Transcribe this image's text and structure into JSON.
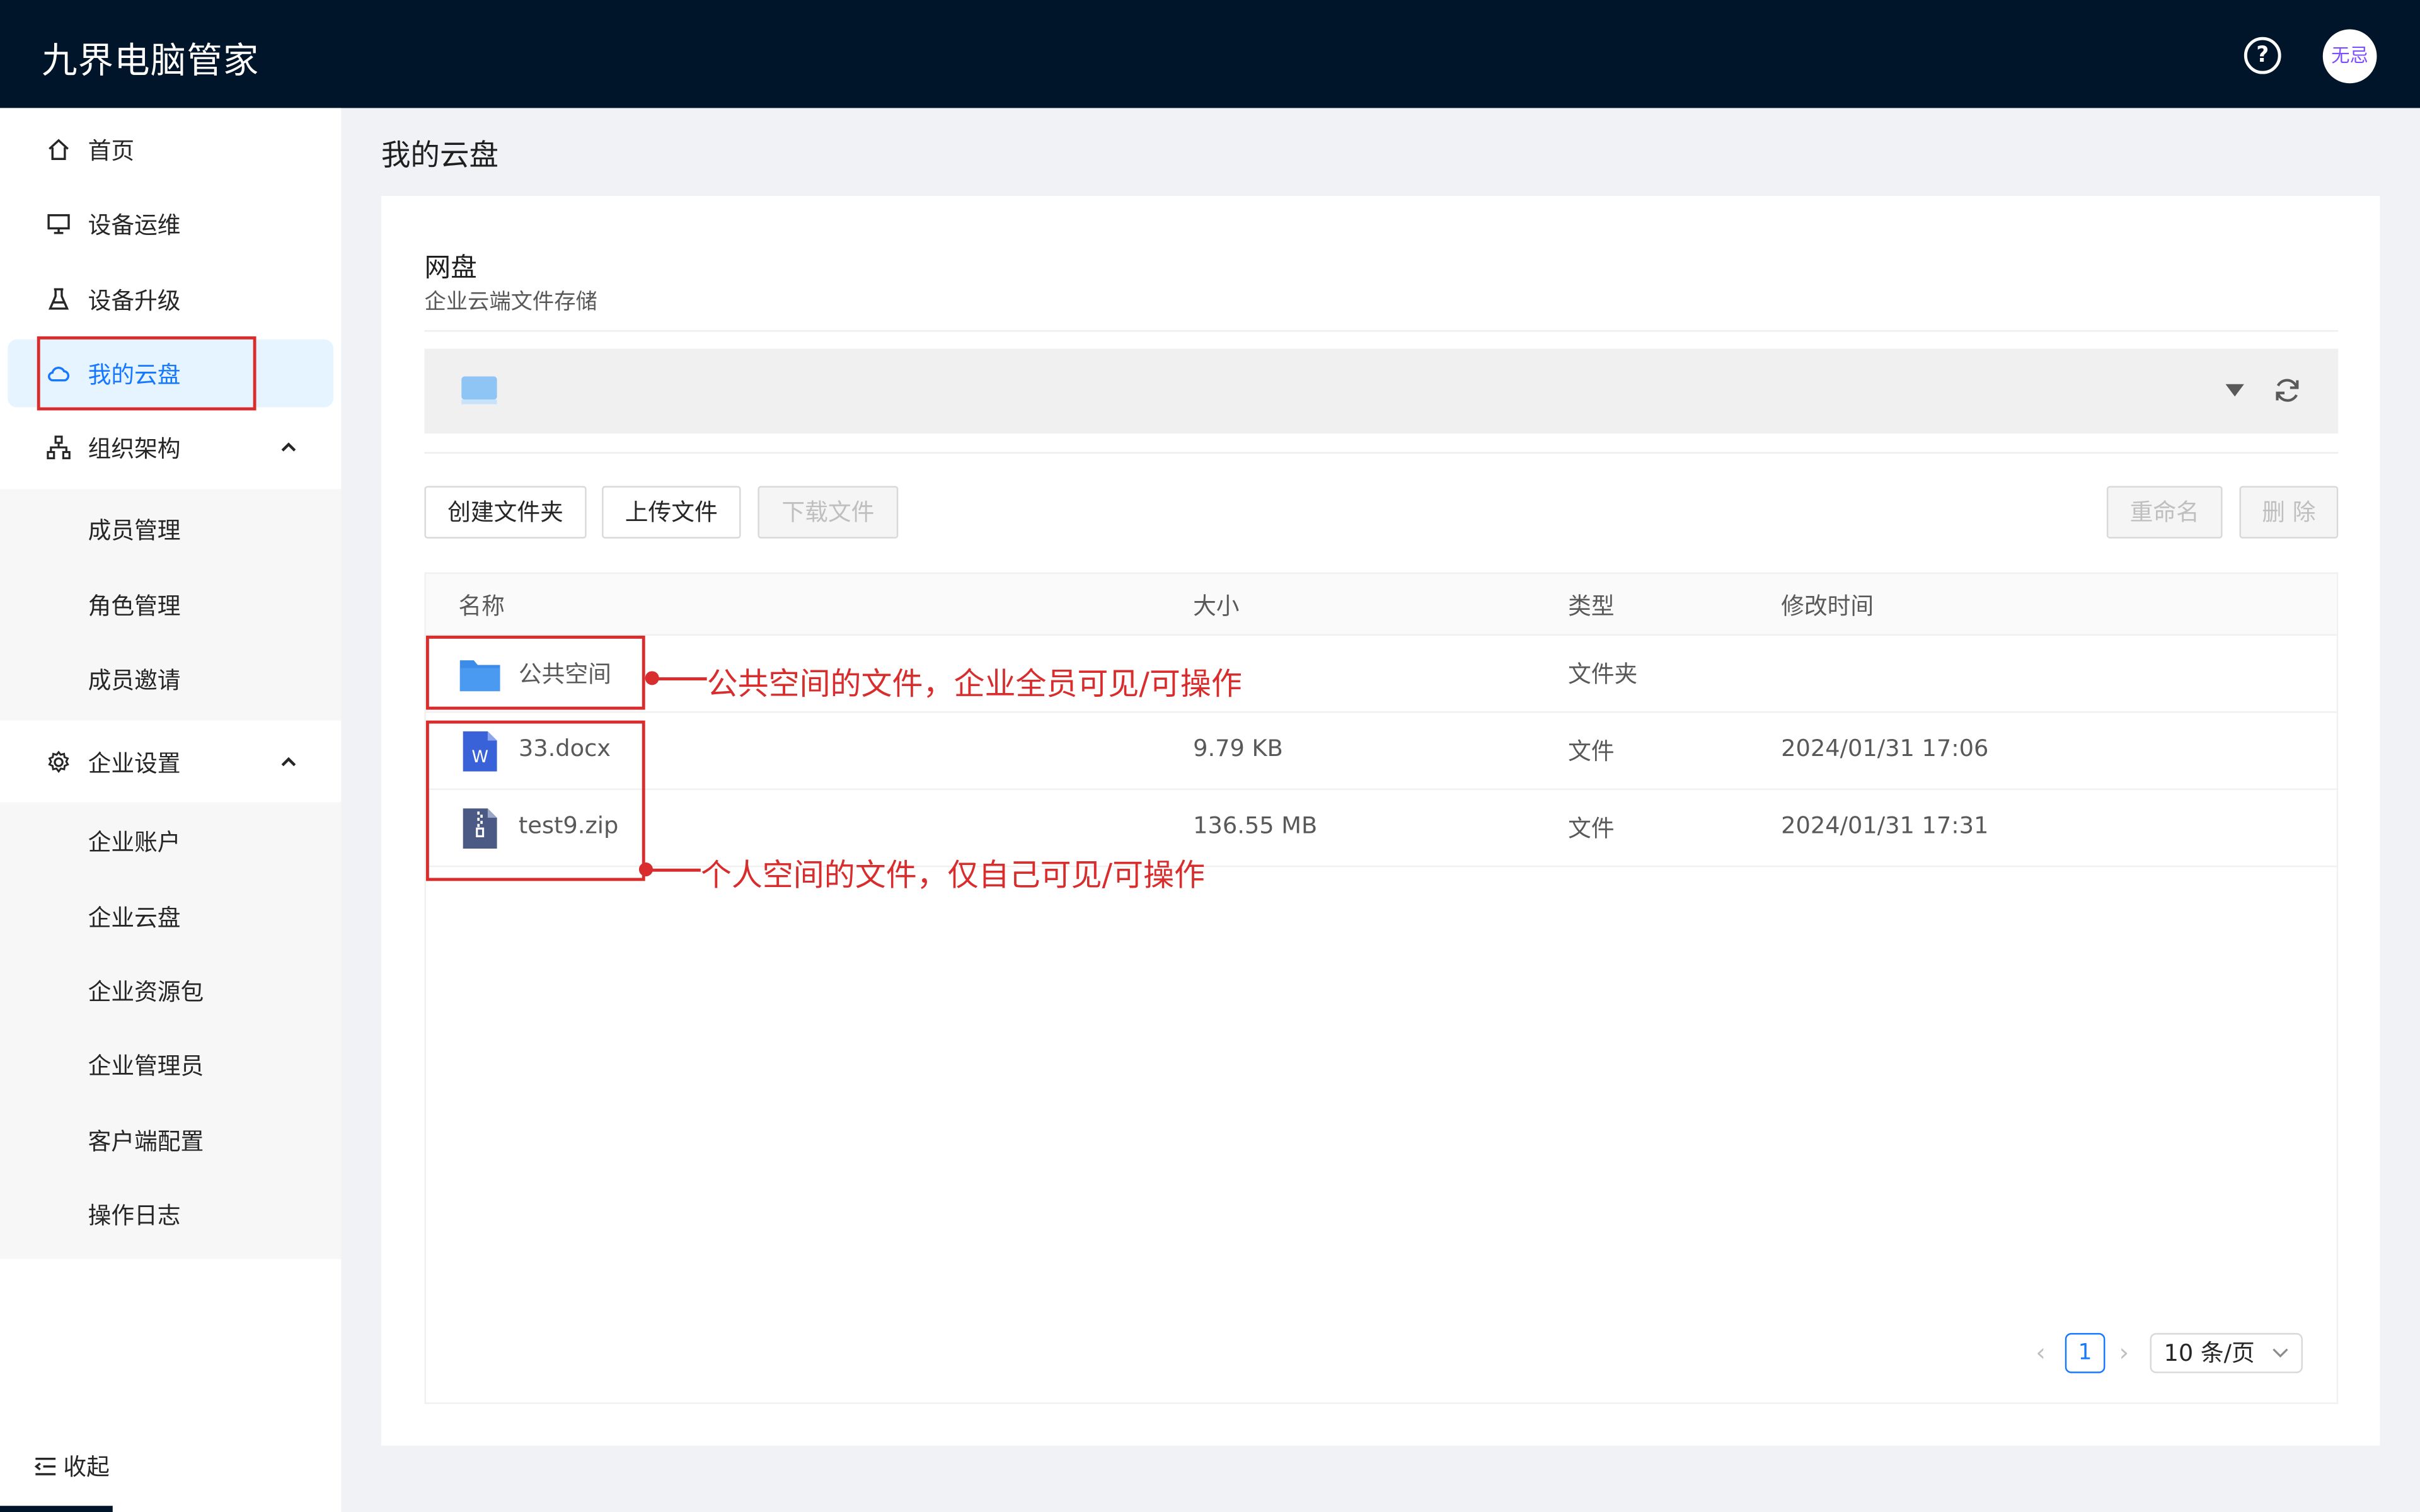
{
  "app": {
    "title": "九界电脑管家",
    "avatar_text": "无忌"
  },
  "sidebar": {
    "items": [
      {
        "label": "首页",
        "icon": "home-icon"
      },
      {
        "label": "设备运维",
        "icon": "monitor-icon"
      },
      {
        "label": "设备升级",
        "icon": "flask-icon"
      },
      {
        "label": "我的云盘",
        "icon": "cloud-icon",
        "active": true
      },
      {
        "label": "组织架构",
        "icon": "org-icon",
        "expanded": true
      },
      {
        "label": "企业设置",
        "icon": "gear-icon",
        "expanded": true
      }
    ],
    "org_sub": [
      "成员管理",
      "角色管理",
      "成员邀请"
    ],
    "settings_sub": [
      "企业账户",
      "企业云盘",
      "企业资源包",
      "企业管理员",
      "客户端配置",
      "操作日志"
    ],
    "collapse_label": "收起"
  },
  "main": {
    "page_title": "我的云盘",
    "card_title": "网盘",
    "card_subtitle": "企业云端文件存储",
    "toolbar": {
      "create_folder": "创建文件夹",
      "upload": "上传文件",
      "download": "下载文件",
      "rename": "重命名",
      "delete": "删 除"
    },
    "table": {
      "columns": [
        "名称",
        "大小",
        "类型",
        "修改时间"
      ],
      "rows": [
        {
          "name": "公共空间",
          "size": "",
          "type": "文件夹",
          "modified": "",
          "icon": "folder-icon"
        },
        {
          "name": "33.docx",
          "size": "9.79 KB",
          "type": "文件",
          "modified": "2024/01/31 17:06",
          "icon": "word-file-icon"
        },
        {
          "name": "test9.zip",
          "size": "136.55 MB",
          "type": "文件",
          "modified": "2024/01/31 17:31",
          "icon": "zip-file-icon"
        }
      ]
    },
    "annotations": {
      "public": "公共空间的文件，企业全员可见/可操作",
      "personal": "个人空间的文件，仅自己可见/可操作"
    },
    "pagination": {
      "current": "1",
      "page_size": "10 条/页"
    }
  },
  "colors": {
    "header_bg": "#001529",
    "accent": "#1677ff",
    "annotation": "#d92d2d"
  }
}
